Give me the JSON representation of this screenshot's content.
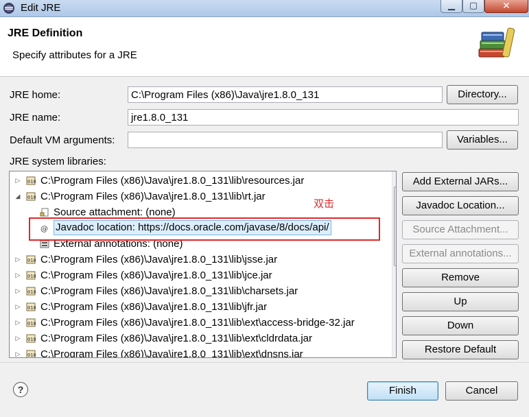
{
  "window": {
    "title": "Edit JRE"
  },
  "header": {
    "title": "JRE Definition",
    "subtitle": "Specify attributes for a JRE"
  },
  "form": {
    "jre_home_label": "JRE home:",
    "jre_home_value": "C:\\Program Files (x86)\\Java\\jre1.8.0_131",
    "directory_button": "Directory...",
    "jre_name_label": "JRE name:",
    "jre_name_value": "jre1.8.0_131",
    "vm_args_label": "Default VM arguments:",
    "vm_args_value": "",
    "variables_button": "Variables...",
    "libraries_label": "JRE system libraries:"
  },
  "tree": {
    "rows": [
      {
        "text": "C:\\Program Files (x86)\\Java\\jre1.8.0_131\\lib\\resources.jar",
        "level": 0,
        "expanded": false
      },
      {
        "text": "C:\\Program Files (x86)\\Java\\jre1.8.0_131\\lib\\rt.jar",
        "level": 0,
        "expanded": true
      },
      {
        "text": "Source attachment: (none)",
        "level": 1
      },
      {
        "text": "Javadoc location: https://docs.oracle.com/javase/8/docs/api/",
        "level": 1,
        "selected": true
      },
      {
        "text": "External annotations: (none)",
        "level": 1
      },
      {
        "text": "C:\\Program Files (x86)\\Java\\jre1.8.0_131\\lib\\jsse.jar",
        "level": 0,
        "expanded": false
      },
      {
        "text": "C:\\Program Files (x86)\\Java\\jre1.8.0_131\\lib\\jce.jar",
        "level": 0,
        "expanded": false
      },
      {
        "text": "C:\\Program Files (x86)\\Java\\jre1.8.0_131\\lib\\charsets.jar",
        "level": 0,
        "expanded": false
      },
      {
        "text": "C:\\Program Files (x86)\\Java\\jre1.8.0_131\\lib\\jfr.jar",
        "level": 0,
        "expanded": false
      },
      {
        "text": "C:\\Program Files (x86)\\Java\\jre1.8.0_131\\lib\\ext\\access-bridge-32.jar",
        "level": 0,
        "expanded": false
      },
      {
        "text": "C:\\Program Files (x86)\\Java\\jre1.8.0_131\\lib\\ext\\cldrdata.jar",
        "level": 0,
        "expanded": false
      },
      {
        "text": "C:\\Program Files (x86)\\Java\\jre1.8.0_131\\lib\\ext\\dnsns.jar",
        "level": 0,
        "expanded": false
      }
    ]
  },
  "annotation": {
    "text": "双击",
    "color": "#e0282a"
  },
  "side_buttons": {
    "add_external_jars": "Add External JARs...",
    "javadoc_location": "Javadoc Location...",
    "source_attachment": "Source Attachment...",
    "external_annotations": "External annotations...",
    "remove": "Remove",
    "up": "Up",
    "down": "Down",
    "restore_default": "Restore Default"
  },
  "footer": {
    "help": "?",
    "finish": "Finish",
    "cancel": "Cancel"
  }
}
